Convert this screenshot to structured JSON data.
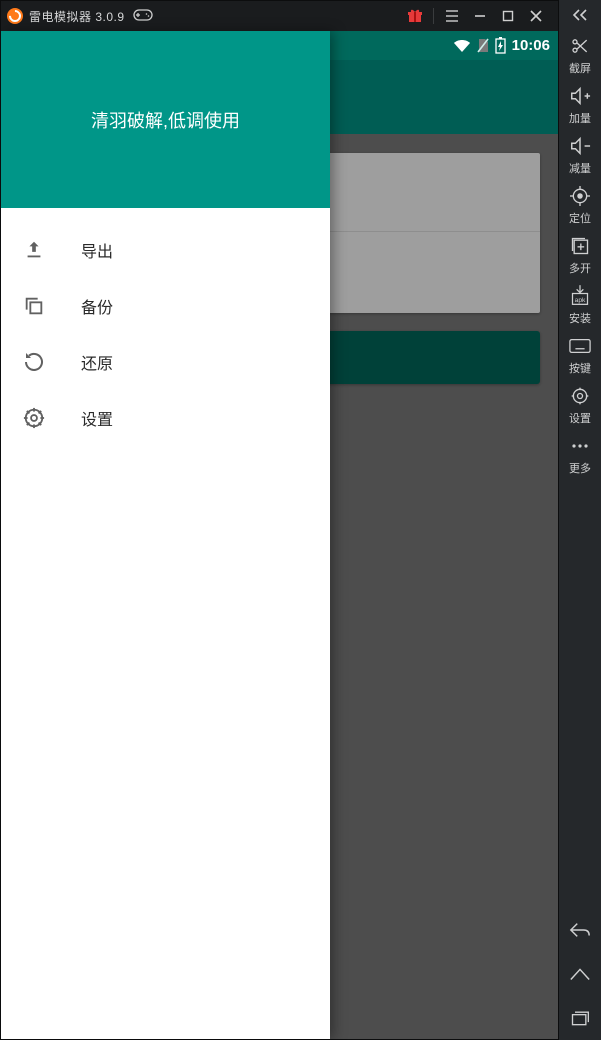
{
  "titlebar": {
    "app_name": "雷电模拟器",
    "version": "3.0.9"
  },
  "statusbar": {
    "time": "10:06"
  },
  "drawer": {
    "header": "清羽破解,低调使用",
    "items": [
      {
        "label": "导出"
      },
      {
        "label": "备份"
      },
      {
        "label": "还原"
      },
      {
        "label": "设置"
      }
    ]
  },
  "sidebar": {
    "items": [
      {
        "label": "截屏"
      },
      {
        "label": "加量"
      },
      {
        "label": "减量"
      },
      {
        "label": "定位"
      },
      {
        "label": "多开"
      },
      {
        "label": "安装"
      },
      {
        "label": "按键"
      },
      {
        "label": "设置"
      },
      {
        "label": "更多"
      }
    ]
  }
}
